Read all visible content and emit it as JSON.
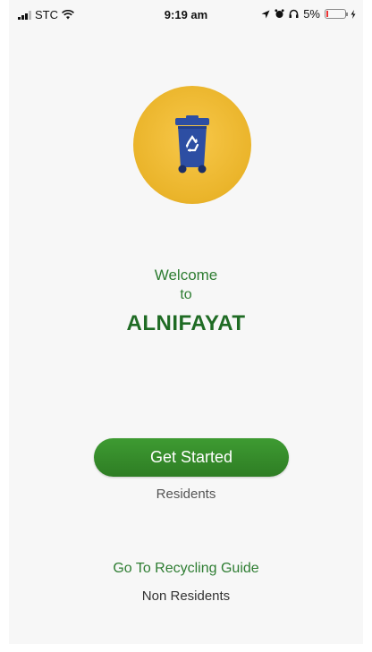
{
  "status_bar": {
    "carrier": "STC",
    "time": "9:19 am",
    "battery_percent": "5%",
    "icons": [
      "signal-icon",
      "wifi-icon",
      "location-icon",
      "alarm-icon",
      "headphones-icon",
      "battery-icon",
      "charging-icon"
    ]
  },
  "logo": {
    "icon": "recycling-bin-icon",
    "circle_color": "#F1BC34",
    "bin_color": "#2D4EA3"
  },
  "welcome": {
    "line1": "Welcome",
    "line2": "to",
    "app_name": "ALNIFAYAT"
  },
  "actions": {
    "get_started_label": "Get Started",
    "residents_caption": "Residents",
    "recycling_guide_label": "Go To Recycling Guide",
    "non_residents_caption": "Non Residents"
  },
  "colors": {
    "accent_green": "#2E7D32",
    "button_green": "#37902C",
    "background": "#F7F7F7"
  }
}
